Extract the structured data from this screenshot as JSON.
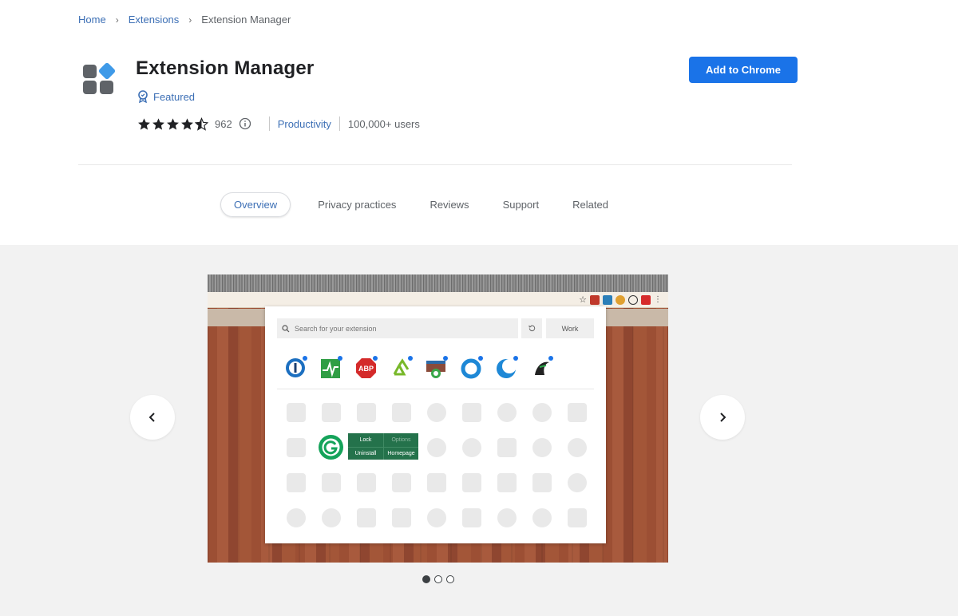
{
  "breadcrumb": {
    "home": "Home",
    "extensions": "Extensions",
    "current": "Extension Manager"
  },
  "extension": {
    "title": "Extension Manager",
    "featured_label": "Featured",
    "rating": 4.5,
    "rating_count": "962",
    "category": "Productivity",
    "users": "100,000+ users"
  },
  "actions": {
    "add_label": "Add to Chrome"
  },
  "tabs": [
    {
      "label": "Overview",
      "active": true
    },
    {
      "label": "Privacy practices",
      "active": false
    },
    {
      "label": "Reviews",
      "active": false
    },
    {
      "label": "Support",
      "active": false
    },
    {
      "label": "Related",
      "active": false
    }
  ],
  "screenshot": {
    "search_placeholder": "Search for your extension",
    "profile_label": "Work",
    "context_menu": {
      "lock": "Lock",
      "options": "Options",
      "uninstall": "Uninstall",
      "homepage": "Homepage"
    }
  },
  "carousel": {
    "slide_count": 3,
    "active_index": 0
  },
  "colors": {
    "accent": "#1a73e8",
    "link": "#3c6fb5"
  }
}
